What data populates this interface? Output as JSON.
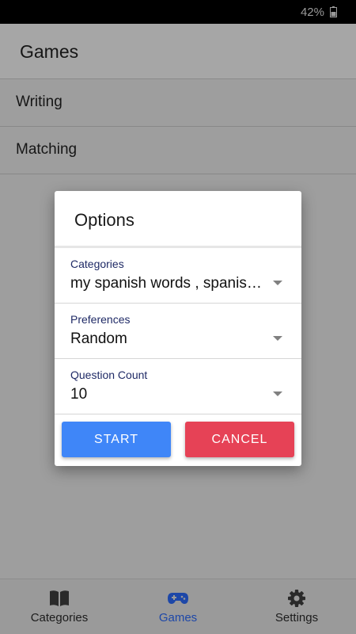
{
  "status_bar": {
    "battery": "42%"
  },
  "header": {
    "title": "Games"
  },
  "games": [
    {
      "label": "Writing"
    },
    {
      "label": "Matching"
    }
  ],
  "dialog": {
    "title": "Options",
    "fields": [
      {
        "label": "Categories",
        "value": "my spanish words , spanish words"
      },
      {
        "label": "Preferences",
        "value": "Random"
      },
      {
        "label": "Question Count",
        "value": "10"
      }
    ],
    "start_label": "START",
    "cancel_label": "CANCEL"
  },
  "bottom_nav": [
    {
      "label": "Categories",
      "icon": "book-icon"
    },
    {
      "label": "Games",
      "icon": "gamepad-icon",
      "active": true
    },
    {
      "label": "Settings",
      "icon": "gear-icon"
    }
  ],
  "colors": {
    "accent": "#1d47a8",
    "start": "#3f86f8",
    "cancel": "#e64256"
  }
}
